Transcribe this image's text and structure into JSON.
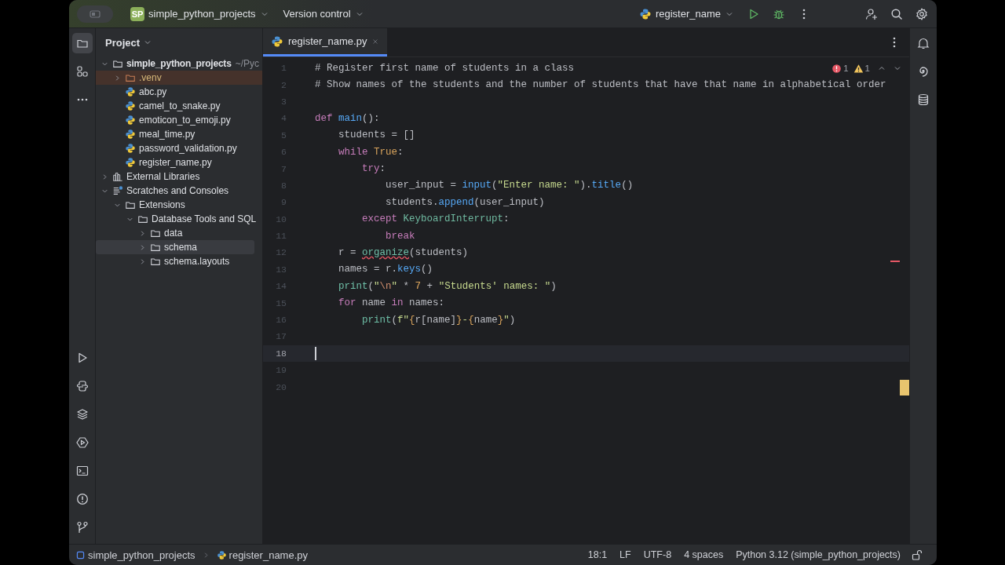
{
  "title_bar": {
    "project_badge": "SP",
    "project": "simple_python_projects",
    "vcs": "Version control",
    "run_config": "register_name"
  },
  "project_panel": {
    "title": "Project",
    "tree": [
      {
        "label": "simple_python_projects",
        "kind": "folder",
        "hint": "~/Pyc",
        "expanded": true,
        "selected": false,
        "excluded": false,
        "children": [
          {
            "label": ".venv",
            "kind": "folder",
            "expanded": false,
            "selected": false,
            "excluded": true
          },
          {
            "label": "abc.py",
            "kind": "file",
            "selected": false,
            "excluded": false
          },
          {
            "label": "camel_to_snake.py",
            "kind": "file",
            "selected": false,
            "excluded": false
          },
          {
            "label": "emoticon_to_emoji.py",
            "kind": "file",
            "selected": false,
            "excluded": false
          },
          {
            "label": "meal_time.py",
            "kind": "file",
            "selected": false,
            "excluded": false
          },
          {
            "label": "password_validation.py",
            "kind": "file",
            "selected": false,
            "excluded": false
          },
          {
            "label": "register_name.py",
            "kind": "file",
            "selected": false,
            "excluded": false
          }
        ]
      },
      {
        "label": "External Libraries",
        "kind": "library",
        "expanded": false,
        "selected": false,
        "excluded": false
      },
      {
        "label": "Scratches and Consoles",
        "kind": "scratches",
        "expanded": true,
        "selected": false,
        "excluded": false,
        "children": [
          {
            "label": "Extensions",
            "kind": "folder",
            "expanded": true,
            "selected": false,
            "excluded": false,
            "children": [
              {
                "label": "Database Tools and SQL",
                "kind": "folder",
                "expanded": true,
                "selected": false,
                "excluded": false,
                "children": [
                  {
                    "label": "data",
                    "kind": "folder",
                    "expanded": false,
                    "selected": false,
                    "excluded": false
                  },
                  {
                    "label": "schema",
                    "kind": "folder",
                    "expanded": false,
                    "selected": true,
                    "excluded": false
                  },
                  {
                    "label": "schema.layouts",
                    "kind": "folder",
                    "expanded": false,
                    "selected": false,
                    "excluded": false
                  }
                ]
              }
            ]
          }
        ]
      }
    ]
  },
  "editor": {
    "tabs": [
      {
        "label": "register_name.py",
        "selected": true
      }
    ],
    "inspections": {
      "errors": "1",
      "warnings": "1"
    },
    "lines": [
      {
        "number": "1",
        "current": false,
        "tokens": [
          {
            "kind": "comment",
            "text": "# Register first name of students in a class"
          }
        ]
      },
      {
        "number": "2",
        "current": false,
        "tokens": [
          {
            "kind": "comment",
            "text": "# Show names of the students and the number of students that have that name in alphabetical order"
          }
        ]
      },
      {
        "number": "3",
        "current": false
      },
      {
        "number": "4",
        "current": false,
        "tokens": [
          {
            "kind": "kw",
            "text": "def "
          },
          {
            "kind": "fn",
            "text": "main"
          },
          {
            "kind": "plain",
            "text": "():"
          }
        ]
      },
      {
        "number": "5",
        "current": false,
        "tokens": [
          {
            "kind": "plain",
            "text": "    students = []"
          }
        ]
      },
      {
        "number": "6",
        "current": false,
        "tokens": [
          {
            "kind": "kw",
            "text": "    while "
          },
          {
            "kind": "const",
            "text": "True"
          },
          {
            "kind": "plain",
            "text": ":"
          }
        ]
      },
      {
        "number": "7",
        "current": false,
        "tokens": [
          {
            "kind": "kw",
            "text": "        try"
          },
          {
            "kind": "plain",
            "text": ":"
          }
        ]
      },
      {
        "number": "8",
        "current": false,
        "tokens": [
          {
            "kind": "plain",
            "text": "            user_input = "
          },
          {
            "kind": "fn",
            "text": "input"
          },
          {
            "kind": "plain",
            "text": "("
          },
          {
            "kind": "str",
            "text": "\"Enter name: \""
          },
          {
            "kind": "plain",
            "text": ")."
          },
          {
            "kind": "fn",
            "text": "title"
          },
          {
            "kind": "plain",
            "text": "()"
          }
        ]
      },
      {
        "number": "9",
        "current": false,
        "tokens": [
          {
            "kind": "plain",
            "text": "            students."
          },
          {
            "kind": "fn",
            "text": "append"
          },
          {
            "kind": "plain",
            "text": "(user_input)"
          }
        ]
      },
      {
        "number": "10",
        "current": false,
        "tokens": [
          {
            "kind": "kw",
            "text": "        except "
          },
          {
            "kind": "cls",
            "text": "KeyboardInterrupt"
          },
          {
            "kind": "plain",
            "text": ":"
          }
        ]
      },
      {
        "number": "11",
        "current": false,
        "tokens": [
          {
            "kind": "kw",
            "text": "            break"
          }
        ]
      },
      {
        "number": "12",
        "current": false,
        "tokens": [
          {
            "kind": "plain",
            "text": "    r = "
          },
          {
            "kind": "error",
            "text": "organize"
          },
          {
            "kind": "plain",
            "text": "(students)"
          }
        ]
      },
      {
        "number": "13",
        "current": false,
        "tokens": [
          {
            "kind": "plain",
            "text": "    names = r."
          },
          {
            "kind": "fn",
            "text": "keys"
          },
          {
            "kind": "plain",
            "text": "()"
          }
        ]
      },
      {
        "number": "14",
        "current": false,
        "tokens": [
          {
            "kind": "builtin",
            "text": "    print"
          },
          {
            "kind": "plain",
            "text": "("
          },
          {
            "kind": "str",
            "text": "\""
          },
          {
            "kind": "escape",
            "text": "\\n"
          },
          {
            "kind": "str",
            "text": "\""
          },
          {
            "kind": "plain",
            "text": " * "
          },
          {
            "kind": "const",
            "text": "7"
          },
          {
            "kind": "plain",
            "text": " + "
          },
          {
            "kind": "str",
            "text": "\"Students' names: \""
          },
          {
            "kind": "plain",
            "text": ")"
          }
        ]
      },
      {
        "number": "15",
        "current": false,
        "tokens": [
          {
            "kind": "kw",
            "text": "    for "
          },
          {
            "kind": "plain",
            "text": "name "
          },
          {
            "kind": "kw",
            "text": "in "
          },
          {
            "kind": "plain",
            "text": "names:"
          }
        ]
      },
      {
        "number": "16",
        "current": false,
        "tokens": [
          {
            "kind": "builtin",
            "text": "        print"
          },
          {
            "kind": "plain",
            "text": "("
          },
          {
            "kind": "str",
            "text": "f\""
          },
          {
            "kind": "const",
            "text": "{"
          },
          {
            "kind": "plain",
            "text": "r[name]"
          },
          {
            "kind": "const",
            "text": "}"
          },
          {
            "kind": "str",
            "text": "-"
          },
          {
            "kind": "const",
            "text": "{"
          },
          {
            "kind": "plain",
            "text": "name"
          },
          {
            "kind": "const",
            "text": "}"
          },
          {
            "kind": "str",
            "text": "\""
          },
          {
            "kind": "plain",
            "text": ")"
          }
        ]
      },
      {
        "number": "17",
        "current": false
      },
      {
        "number": "18",
        "current": true
      },
      {
        "number": "19",
        "current": false
      },
      {
        "number": "20",
        "current": false
      }
    ]
  },
  "status_bar": {
    "breadcrumbs": [
      {
        "label": "simple_python_projects",
        "kind": "module"
      },
      {
        "label": "register_name.py",
        "kind": "file"
      }
    ],
    "items": [
      "18:1",
      "LF",
      "UTF-8",
      "4 spaces",
      "Python 3.12 (simple_python_projects)"
    ]
  }
}
